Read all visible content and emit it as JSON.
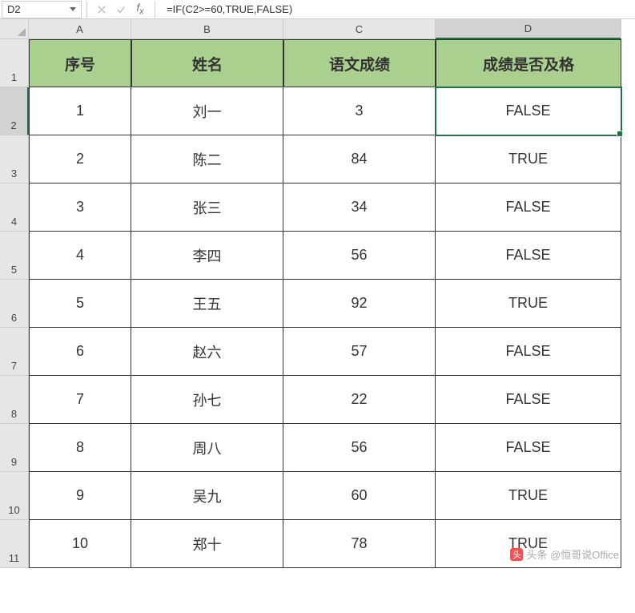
{
  "formula_bar": {
    "name_box": "D2",
    "formula": "=IF(C2>=60,TRUE,FALSE)"
  },
  "columns": [
    "A",
    "B",
    "C",
    "D"
  ],
  "headers": {
    "A": "序号",
    "B": "姓名",
    "C": "语文成绩",
    "D": "成绩是否及格"
  },
  "rows": [
    {
      "num": "1",
      "A": "1",
      "B": "刘一",
      "C": "3",
      "D": "FALSE"
    },
    {
      "num": "2",
      "A": "2",
      "B": "陈二",
      "C": "84",
      "D": "TRUE"
    },
    {
      "num": "3",
      "A": "3",
      "B": "张三",
      "C": "34",
      "D": "FALSE"
    },
    {
      "num": "4",
      "A": "4",
      "B": "李四",
      "C": "56",
      "D": "FALSE"
    },
    {
      "num": "5",
      "A": "5",
      "B": "王五",
      "C": "92",
      "D": "TRUE"
    },
    {
      "num": "6",
      "A": "6",
      "B": "赵六",
      "C": "57",
      "D": "FALSE"
    },
    {
      "num": "7",
      "A": "7",
      "B": "孙七",
      "C": "22",
      "D": "FALSE"
    },
    {
      "num": "8",
      "A": "8",
      "B": "周八",
      "C": "56",
      "D": "FALSE"
    },
    {
      "num": "9",
      "A": "9",
      "B": "吴九",
      "C": "60",
      "D": "TRUE"
    },
    {
      "num": "10",
      "A": "10",
      "B": "郑十",
      "C": "78",
      "D": "TRUE"
    }
  ],
  "selected": {
    "col": "D",
    "row": 2
  },
  "watermark": "头条 @恒哥说Office"
}
